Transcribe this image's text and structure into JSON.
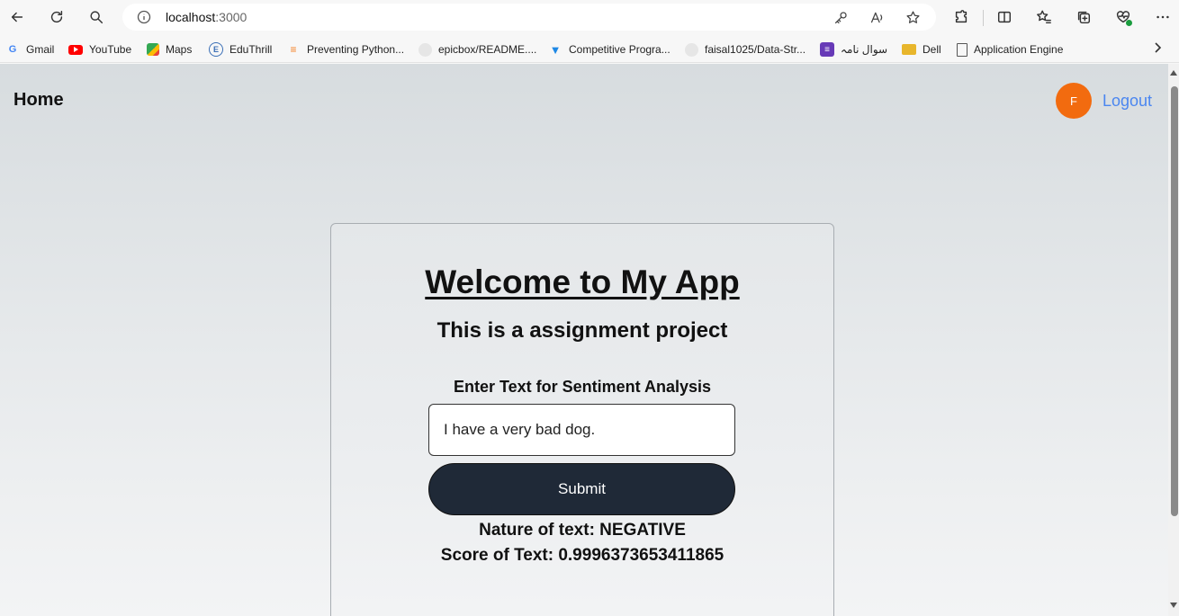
{
  "browser": {
    "url_host": "localhost",
    "url_port": ":3000"
  },
  "bookmarks": [
    {
      "label": "Gmail",
      "icon": "google-icon",
      "color": "#4285f4"
    },
    {
      "label": "YouTube",
      "icon": "youtube-icon",
      "color": "#ff0000"
    },
    {
      "label": "Maps",
      "icon": "maps-icon",
      "color": "#34a853"
    },
    {
      "label": "EduThrill",
      "icon": "eduthrill-icon",
      "color": "#3b6fb6"
    },
    {
      "label": "Preventing Python...",
      "icon": "stackoverflow-icon",
      "color": "#f48024"
    },
    {
      "label": "epicbox/README....",
      "icon": "github-icon",
      "color": "#999999"
    },
    {
      "label": "Competitive Progra...",
      "icon": "bookmark-flag-icon",
      "color": "#1e88e5"
    },
    {
      "label": "faisal1025/Data-Str...",
      "icon": "github-icon",
      "color": "#999999"
    },
    {
      "label": "سوال نامہ",
      "icon": "form-icon",
      "color": "#673ab7"
    },
    {
      "label": "Dell",
      "icon": "folder-icon",
      "color": "#e8b62c"
    },
    {
      "label": "Application Engine",
      "icon": "page-icon",
      "color": "#555555"
    }
  ],
  "app": {
    "nav_home": "Home",
    "avatar_letter": "F",
    "logout": "Logout",
    "accent_color": "#f26b0f",
    "link_color": "#4a86f0"
  },
  "card": {
    "title": "Welcome to My App",
    "subtitle": "This is a assignment project",
    "input_label": "Enter Text for Sentiment Analysis",
    "input_value": "I have a very bad dog.",
    "submit_label": "Submit",
    "result_nature": "Nature of text: NEGATIVE",
    "result_score": "Score of Text: 0.9996373653411865"
  }
}
